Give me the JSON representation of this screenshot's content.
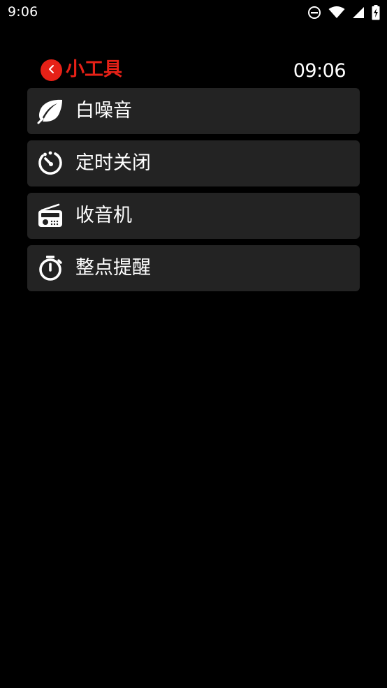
{
  "status_bar": {
    "time": "9:06",
    "icons": [
      "do-not-disturb-icon",
      "wifi-icon",
      "signal-icon",
      "battery-charging-icon"
    ]
  },
  "header": {
    "title": "小工具",
    "clock": "09:06",
    "back_icon": "chevron-left-icon"
  },
  "menu": {
    "items": [
      {
        "label": "白噪音",
        "icon": "leaf-icon"
      },
      {
        "label": "定时关闭",
        "icon": "timer-icon"
      },
      {
        "label": "收音机",
        "icon": "radio-icon"
      },
      {
        "label": "整点提醒",
        "icon": "stopwatch-icon"
      }
    ]
  },
  "colors": {
    "accent": "#e62117",
    "background": "#000000",
    "item_background": "#232323",
    "text": "#ffffff"
  }
}
